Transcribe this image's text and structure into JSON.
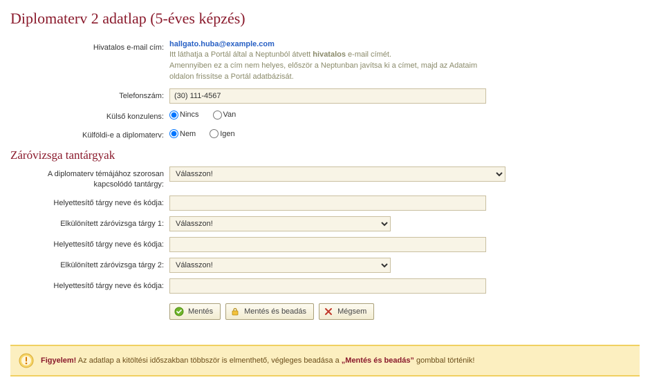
{
  "page_title": "Diplomaterv 2 adatlap (5-éves képzés)",
  "email_label": "Hivatalos e-mail cím:",
  "email_value": "hallgato.huba@example.com",
  "email_hint_1": "Itt láthatja a Portál által a Neptunból átvett ",
  "email_hint_1_strong": "hivatalos",
  "email_hint_1_tail": " e-mail címét.",
  "email_hint_2": "Amennyiben ez a cím nem helyes, először a Neptunban javítsa ki a címet, majd az Adataim oldalon frissítse a Portál adatbázisát.",
  "phone_label": "Telefonszám:",
  "phone_value": "(30) 111-4567",
  "ext_cons_label": "Külső konzulens:",
  "ext_cons_opt_none": "Nincs",
  "ext_cons_opt_yes": "Van",
  "foreign_label": "Külföldi-e a diplomaterv:",
  "foreign_opt_no": "Nem",
  "foreign_opt_yes": "Igen",
  "section_exam": "Záróvizsga tantárgyak",
  "related_label": "A diplomaterv témájához szorosan kapcsolódó tantárgy:",
  "select_placeholder": "Válasszon!",
  "subst_label": "Helyettesítő tárgy neve és kódja:",
  "exam1_label": "Elkülönített záróvizsga tárgy 1:",
  "exam2_label": "Elkülönített záróvizsga tárgy 2:",
  "btn_save": "Mentés",
  "btn_submit": "Mentés és beadás",
  "btn_cancel": "Mégsem",
  "alert_strong": "Figyelem!",
  "alert_text_1": " Az adatlap a kitöltési időszakban többször is elmenthető, végleges beadása a ",
  "alert_strong2": "„Mentés és beadás”",
  "alert_text_2": " gombbal történik!"
}
